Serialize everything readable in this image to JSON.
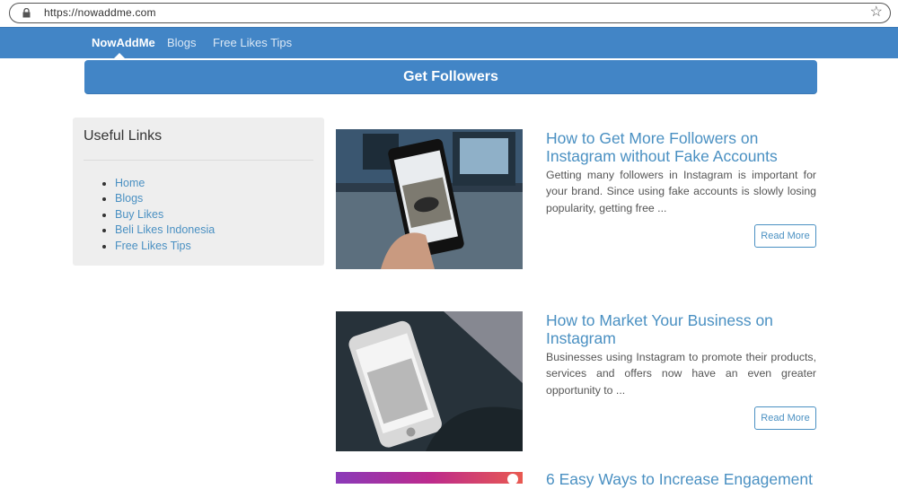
{
  "browser": {
    "url": "https://nowaddme.com"
  },
  "nav": {
    "brand": "NowAddMe",
    "items": [
      "Blogs",
      "Free Likes Tips"
    ]
  },
  "cta": {
    "label": "Get Followers"
  },
  "sidebar": {
    "title": "Useful Links",
    "links": [
      "Home",
      "Blogs",
      "Buy Likes",
      "Beli Likes Indonesia",
      "Free Likes Tips"
    ]
  },
  "posts": [
    {
      "title": "How to Get More Followers on Instagram without Fake Accounts",
      "excerpt": "Getting many followers in Instagram is important for your brand. Since using fake accounts is slowly losing popularity, getting free ...",
      "read_more": "Read More"
    },
    {
      "title": "How to Market Your Business on Instagram",
      "excerpt": "Businesses using Instagram to promote their products, services and offers now have an even greater opportunity to ...",
      "read_more": "Read More"
    },
    {
      "title": "6 Easy Ways to Increase Engagement"
    }
  ],
  "colors": {
    "accent": "#4285c6",
    "link": "#4a90c2"
  }
}
